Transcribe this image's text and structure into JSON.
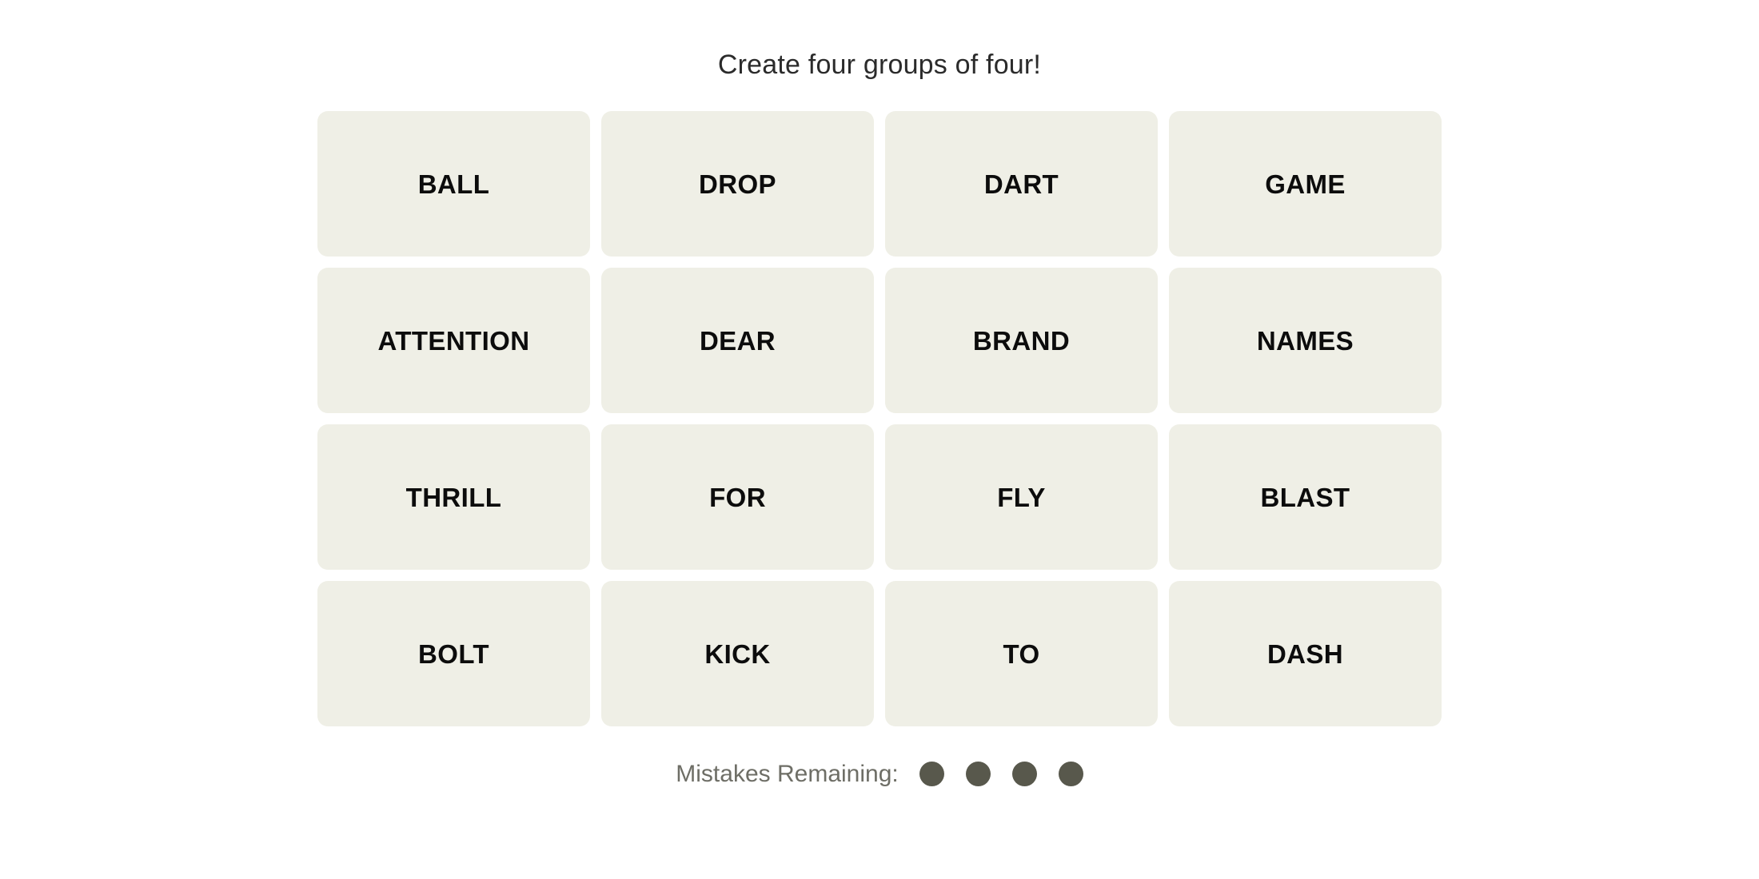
{
  "header": {
    "title": "Create four groups of four!"
  },
  "board": {
    "rows": [
      {
        "tiles": [
          {
            "label": "BALL"
          },
          {
            "label": "DROP"
          },
          {
            "label": "DART"
          },
          {
            "label": "GAME"
          }
        ]
      },
      {
        "tiles": [
          {
            "label": "ATTENTION"
          },
          {
            "label": "DEAR"
          },
          {
            "label": "BRAND"
          },
          {
            "label": "NAMES"
          }
        ]
      },
      {
        "tiles": [
          {
            "label": "THRILL"
          },
          {
            "label": "FOR"
          },
          {
            "label": "FLY"
          },
          {
            "label": "BLAST"
          }
        ]
      },
      {
        "tiles": [
          {
            "label": "BOLT"
          },
          {
            "label": "KICK"
          },
          {
            "label": "TO"
          },
          {
            "label": "DASH"
          }
        ]
      }
    ],
    "tile_color": "#efefe6",
    "tile_text_color": "#0c0c0c"
  },
  "footer": {
    "mistakes_label": "Mistakes Remaining:",
    "mistakes_remaining": 4,
    "dots": [
      {
        "name": "mistake-dot-1",
        "filled": true
      },
      {
        "name": "mistake-dot-2",
        "filled": true
      },
      {
        "name": "mistake-dot-3",
        "filled": true
      },
      {
        "name": "mistake-dot-4",
        "filled": true
      }
    ],
    "dot_color": "#58584c",
    "label_color": "#6e6e66"
  },
  "page": {
    "background_color": "#ffffff",
    "title_color": "#2b2b2b"
  }
}
